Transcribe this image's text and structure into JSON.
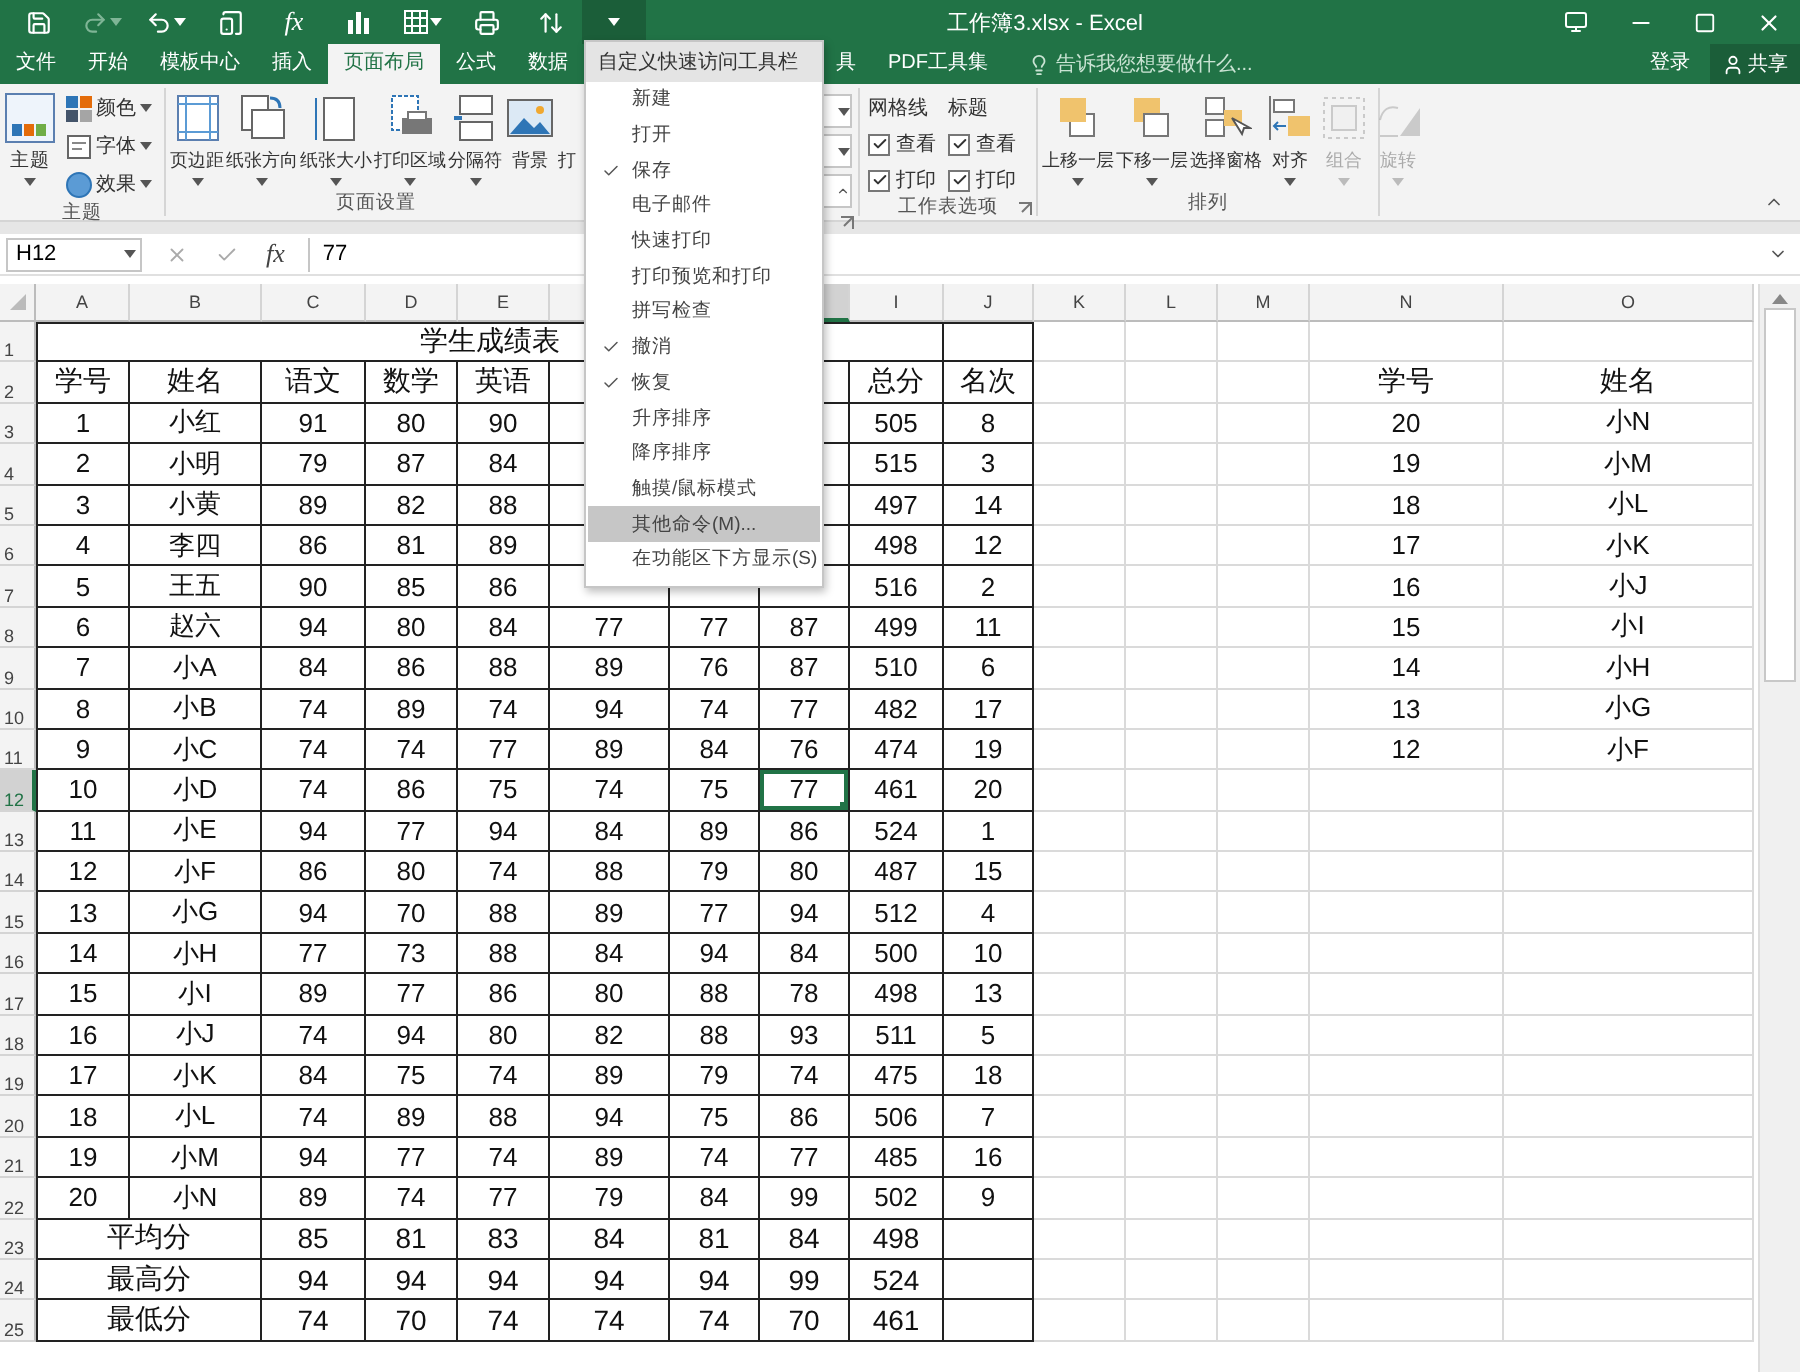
{
  "window": {
    "title": "工作簿3.xlsx - Excel"
  },
  "quick_access": {
    "function_label": "fx"
  },
  "tabs": [
    {
      "label": "文件",
      "selected": false
    },
    {
      "label": "开始",
      "selected": false
    },
    {
      "label": "模板中心",
      "selected": false
    },
    {
      "label": "插入",
      "selected": false
    },
    {
      "label": "页面布局",
      "selected": true
    },
    {
      "label": "公式",
      "selected": false
    },
    {
      "label": "数据",
      "selected": false
    }
  ],
  "tabs_after_menu": [
    {
      "label": "具",
      "selected": false
    },
    {
      "label": "PDF工具集",
      "selected": false
    }
  ],
  "tell_me": {
    "placeholder": "告诉我您想要做什么..."
  },
  "account": {
    "sign_in": "登录",
    "share": "共享"
  },
  "ribbon": {
    "theme_group": {
      "label": "主题",
      "main": "主题",
      "items": [
        "颜色",
        "字体",
        "效果"
      ]
    },
    "page_setup_group": {
      "label": "页面设置",
      "buttons": [
        "页边距",
        "纸张方向",
        "纸张大小",
        "打印区域",
        "分隔符",
        "背景",
        "打"
      ]
    },
    "sheet_options_group": {
      "label": "工作表选项",
      "columns": [
        {
          "title": "网格线",
          "options": [
            {
              "label": "查看",
              "checked": true
            },
            {
              "label": "打印",
              "checked": true
            }
          ]
        },
        {
          "title": "标题",
          "options": [
            {
              "label": "查看",
              "checked": true
            },
            {
              "label": "打印",
              "checked": true
            }
          ]
        }
      ]
    },
    "arrange_group": {
      "label": "排列",
      "buttons": [
        {
          "label": "上移一层",
          "disabled": false
        },
        {
          "label": "下移一层",
          "disabled": false
        },
        {
          "label": "选择窗格",
          "disabled": false
        },
        {
          "label": "对齐",
          "disabled": false
        },
        {
          "label": "组合",
          "disabled": true
        },
        {
          "label": "旋转",
          "disabled": true
        }
      ]
    }
  },
  "formula_bar": {
    "name_box": "H12",
    "function_label": "fx",
    "value": "77"
  },
  "sheet": {
    "columns": [
      {
        "label": "A",
        "selected": false
      },
      {
        "label": "B",
        "selected": false
      },
      {
        "label": "C",
        "selected": false
      },
      {
        "label": "D",
        "selected": false
      },
      {
        "label": "E",
        "selected": false
      },
      {
        "selected": false
      },
      null,
      {
        "selected": true
      },
      {
        "label": "I",
        "selected": false
      },
      {
        "label": "J",
        "selected": false
      },
      {
        "label": "K",
        "selected": false
      },
      {
        "label": "L",
        "selected": false
      },
      {
        "label": "M",
        "selected": false
      },
      {
        "label": "N",
        "selected": false
      },
      {
        "label": "O",
        "selected": false
      }
    ],
    "rows": [
      {
        "header": "1",
        "kind": "title",
        "selected": false,
        "cells": [
          {
            "text": "学生成绩表",
            "colspan": 9
          }
        ]
      },
      {
        "header": "2",
        "kind": "header",
        "selected": false,
        "cells": [
          "学号",
          "姓名",
          "语文",
          "数学",
          "英语",
          null,
          null,
          null,
          "总分",
          "名次",
          null,
          null,
          null,
          "学号",
          "姓名"
        ]
      },
      {
        "header": "3",
        "kind": "data",
        "selected": false,
        "cells": [
          "1",
          "小红",
          "91",
          "80",
          "90",
          null,
          null,
          null,
          "505",
          "8",
          null,
          null,
          null,
          "20",
          "小N"
        ]
      },
      {
        "header": "4",
        "kind": "data",
        "selected": false,
        "cells": [
          "2",
          "小明",
          "79",
          "87",
          "84",
          null,
          null,
          null,
          "515",
          "3",
          null,
          null,
          null,
          "19",
          "小M"
        ]
      },
      {
        "header": "5",
        "kind": "data",
        "selected": false,
        "cells": [
          "3",
          "小黄",
          "89",
          "82",
          "88",
          null,
          null,
          null,
          "497",
          "14",
          null,
          null,
          null,
          "18",
          "小L"
        ]
      },
      {
        "header": "6",
        "kind": "data",
        "selected": false,
        "cells": [
          "4",
          "李四",
          "86",
          "81",
          "89",
          null,
          null,
          null,
          "498",
          "12",
          null,
          null,
          null,
          "17",
          "小K"
        ]
      },
      {
        "header": "7",
        "kind": "data",
        "selected": false,
        "cells": [
          "5",
          "王五",
          "90",
          "85",
          "86",
          null,
          null,
          null,
          "516",
          "2",
          null,
          null,
          null,
          "16",
          "小J"
        ]
      },
      {
        "header": "8",
        "kind": "data",
        "selected": false,
        "cells": [
          "6",
          "赵六",
          "94",
          "80",
          "84",
          "77",
          "77",
          "87",
          "499",
          "11",
          null,
          null,
          null,
          "15",
          "小I"
        ]
      },
      {
        "header": "9",
        "kind": "data",
        "selected": false,
        "cells": [
          "7",
          "小A",
          "84",
          "86",
          "88",
          "89",
          "76",
          "87",
          "510",
          "6",
          null,
          null,
          null,
          "14",
          "小H"
        ]
      },
      {
        "header": "10",
        "kind": "data",
        "selected": false,
        "cells": [
          "8",
          "小B",
          "74",
          "89",
          "74",
          "94",
          "74",
          "77",
          "482",
          "17",
          null,
          null,
          null,
          "13",
          "小G"
        ]
      },
      {
        "header": "11",
        "kind": "data",
        "selected": false,
        "cells": [
          "9",
          "小C",
          "74",
          "74",
          "77",
          "89",
          "84",
          "76",
          "474",
          "19",
          null,
          null,
          null,
          "12",
          "小F"
        ]
      },
      {
        "header": "12",
        "kind": "data",
        "selected": true,
        "cells": [
          "10",
          "小D",
          "74",
          "86",
          "75",
          "74",
          "75",
          "77",
          "461",
          "20"
        ]
      },
      {
        "header": "13",
        "kind": "data",
        "selected": false,
        "cells": [
          "11",
          "小E",
          "94",
          "77",
          "94",
          "84",
          "89",
          "86",
          "524",
          "1"
        ]
      },
      {
        "header": "14",
        "kind": "data",
        "selected": false,
        "cells": [
          "12",
          "小F",
          "86",
          "80",
          "74",
          "88",
          "79",
          "80",
          "487",
          "15"
        ]
      },
      {
        "header": "15",
        "kind": "data",
        "selected": false,
        "cells": [
          "13",
          "小G",
          "94",
          "70",
          "88",
          "89",
          "77",
          "94",
          "512",
          "4"
        ]
      },
      {
        "header": "16",
        "kind": "data",
        "selected": false,
        "cells": [
          "14",
          "小H",
          "77",
          "73",
          "88",
          "84",
          "94",
          "84",
          "500",
          "10"
        ]
      },
      {
        "header": "17",
        "kind": "data",
        "selected": false,
        "cells": [
          "15",
          "小I",
          "89",
          "77",
          "86",
          "80",
          "88",
          "78",
          "498",
          "13"
        ]
      },
      {
        "header": "18",
        "kind": "data",
        "selected": false,
        "cells": [
          "16",
          "小J",
          "74",
          "94",
          "80",
          "82",
          "88",
          "93",
          "511",
          "5"
        ]
      },
      {
        "header": "19",
        "kind": "data",
        "selected": false,
        "cells": [
          "17",
          "小K",
          "84",
          "75",
          "74",
          "89",
          "79",
          "74",
          "475",
          "18"
        ]
      },
      {
        "header": "20",
        "kind": "data",
        "selected": false,
        "cells": [
          "18",
          "小L",
          "74",
          "89",
          "88",
          "94",
          "75",
          "86",
          "506",
          "7"
        ]
      },
      {
        "header": "21",
        "kind": "data",
        "selected": false,
        "cells": [
          "19",
          "小M",
          "94",
          "77",
          "74",
          "89",
          "74",
          "77",
          "485",
          "16"
        ]
      },
      {
        "header": "22",
        "kind": "data",
        "selected": false,
        "cells": [
          "20",
          "小N",
          "89",
          "74",
          "77",
          "79",
          "84",
          "99",
          "502",
          "9"
        ]
      },
      {
        "header": "23",
        "kind": "summary",
        "selected": false,
        "cells": [
          {
            "text": "平均分",
            "colspan": 2
          },
          "85",
          "81",
          "83",
          "84",
          "81",
          "84",
          "498"
        ]
      },
      {
        "header": "24",
        "kind": "summary",
        "selected": false,
        "cells": [
          {
            "text": "最高分",
            "colspan": 2
          },
          "94",
          "94",
          "94",
          "94",
          "94",
          "99",
          "524"
        ]
      },
      {
        "header": "25",
        "kind": "summary",
        "selected": false,
        "cells": [
          {
            "text": "最低分",
            "colspan": 2
          },
          "74",
          "70",
          "74",
          "74",
          "74",
          "70",
          "461"
        ]
      }
    ]
  },
  "menu": {
    "title": "自定义快速访问工具栏",
    "items": [
      {
        "label": "新建",
        "checked": false,
        "highlighted": false
      },
      {
        "label": "打开",
        "checked": false,
        "highlighted": false
      },
      {
        "label": "保存",
        "checked": true,
        "highlighted": false
      },
      {
        "label": "电子邮件",
        "checked": false,
        "highlighted": false
      },
      {
        "label": "快速打印",
        "checked": false,
        "highlighted": false
      },
      {
        "label": "打印预览和打印",
        "checked": false,
        "highlighted": false
      },
      {
        "label": "拼写检查",
        "checked": false,
        "highlighted": false
      },
      {
        "label": "撤消",
        "checked": true,
        "highlighted": false
      },
      {
        "label": "恢复",
        "checked": true,
        "highlighted": false
      },
      {
        "label": "升序排序",
        "checked": false,
        "highlighted": false
      },
      {
        "label": "降序排序",
        "checked": false,
        "highlighted": false
      },
      {
        "label": "触摸/鼠标模式",
        "checked": false,
        "highlighted": false
      },
      {
        "label": "其他命令(M)...",
        "checked": false,
        "highlighted": true
      },
      {
        "label": "在功能区下方显示(S)",
        "checked": false,
        "highlighted": false
      }
    ]
  }
}
